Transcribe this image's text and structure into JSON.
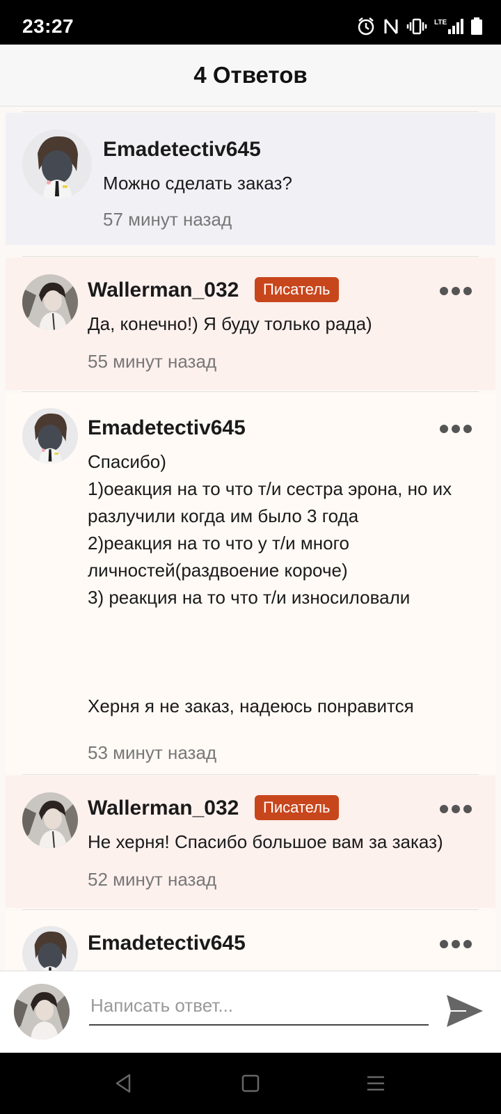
{
  "status_bar": {
    "time": "23:27",
    "icons": [
      "alarm-icon",
      "nfc-icon",
      "vibrate-icon",
      "lte-signal-icon",
      "battery-icon"
    ]
  },
  "header": {
    "title": "4 Ответов"
  },
  "original_comment": {
    "author": "Emadetectiv645",
    "text": "Можно сделать заказ?",
    "time": "57 минут назад"
  },
  "replies": [
    {
      "author": "Wallerman_032",
      "badge": "Писатель",
      "text": "Да, конечно!) Я буду только рада)",
      "time": "55 минут назад"
    },
    {
      "author": "Emadetectiv645",
      "text": "Спасибо)\n1)оеакция на то что т/и сестра эрона, но их разлучили когда им было 3 года\n2)реакция на то что у т/и много личностей(раздвоение короче)\n3) реакция на то что т/и износиловали\n\n\n\nХерня я не заказ, надеюсь понравится",
      "time": "53 минут назад"
    },
    {
      "author": "Wallerman_032",
      "badge": "Писатель",
      "text": "Не херня! Спасибо большое вам за заказ)",
      "time": "52 минут назад"
    },
    {
      "author": "Emadetectiv645"
    }
  ],
  "reply_bar": {
    "placeholder": "Написать ответ..."
  },
  "colors": {
    "badge": "#c8461c",
    "writer_bg": "#fdf1ee",
    "original_bg": "#f1f1f5"
  }
}
